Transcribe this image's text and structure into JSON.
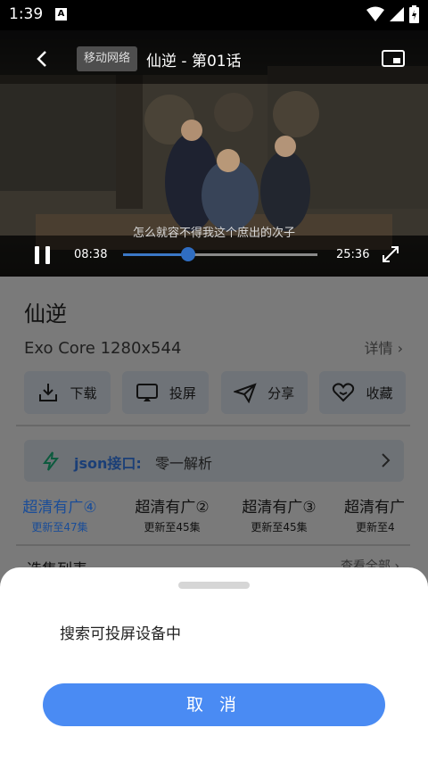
{
  "status": {
    "time": "1:39",
    "notif_icon": "A"
  },
  "player": {
    "network_badge": "移动网络",
    "title": "仙逆 - 第01话",
    "subtitle": "怎么就容不得我这个庶出的次子",
    "current_time": "08:38",
    "total_time": "25:36",
    "progress_fraction": 0.337
  },
  "show": {
    "title": "仙逆",
    "meta": "Exo Core  1280x544",
    "details_link": "详情 ›"
  },
  "actions": [
    {
      "label": "下载",
      "icon": "download-icon"
    },
    {
      "label": "投屏",
      "icon": "cast-icon"
    },
    {
      "label": "分享",
      "icon": "share-icon"
    },
    {
      "label": "收藏",
      "icon": "heart-icon"
    }
  ],
  "api": {
    "label": "json接口:",
    "value": "零一解析"
  },
  "sources": [
    {
      "name": "超清有广④",
      "sub": "更新至47集",
      "active": true
    },
    {
      "name": "超清有广②",
      "sub": "更新至45集",
      "active": false
    },
    {
      "name": "超清有广③",
      "sub": "更新至45集",
      "active": false
    },
    {
      "name": "超清有广",
      "sub": "更新至4",
      "active": false
    }
  ],
  "episodes": {
    "header": "选集列表",
    "more": "查看全部 ›"
  },
  "cast_sheet": {
    "message": "搜索可投屏设备中",
    "cancel_label": "取 消"
  },
  "colors": {
    "accent": "#4a8bf3",
    "progress": "#2f6dc2"
  }
}
